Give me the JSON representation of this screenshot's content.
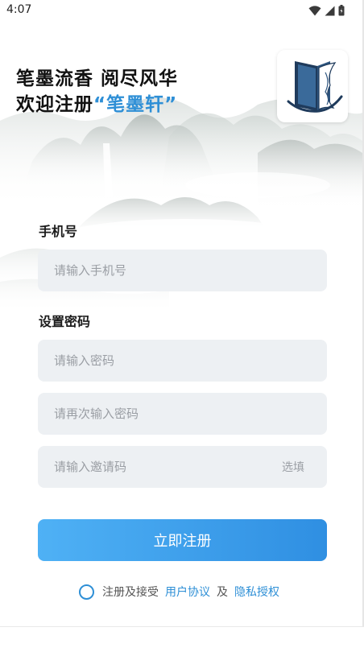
{
  "status_bar": {
    "time": "4:07"
  },
  "headline": {
    "line1": "笔墨流香 阅尽风华",
    "line2_prefix": "欢迎注册",
    "brand": "“笔墨轩”"
  },
  "form": {
    "phone_label": "手机号",
    "phone_placeholder": "请输入手机号",
    "password_label": "设置密码",
    "password_placeholder": "请输入密码",
    "confirm_placeholder": "请再次输入密码",
    "invite_placeholder": "请输入邀请码",
    "invite_optional": "选填"
  },
  "register_button": "立即注册",
  "agreement": {
    "prefix": "注册及接受",
    "user_agreement": "用户协议",
    "and": "及",
    "privacy_policy": "隐私授权"
  },
  "colors": {
    "accent": "#2e8fd6",
    "button_start": "#4fb1f5",
    "button_end": "#2f8fe2",
    "field_bg": "#edf0f3"
  },
  "icons": [
    "wifi-icon",
    "signal-icon",
    "battery-icon",
    "app-logo-book-icon",
    "radio-unchecked-icon"
  ]
}
